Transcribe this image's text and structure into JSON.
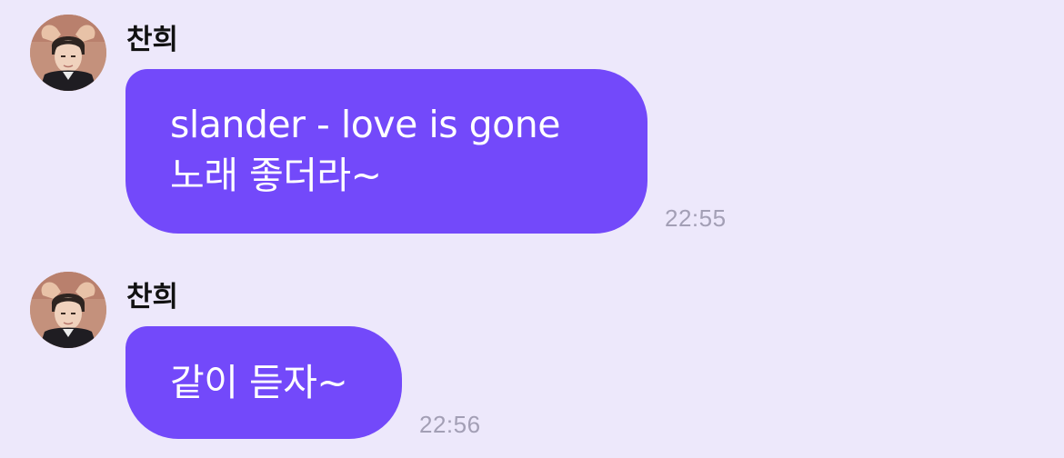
{
  "messages": [
    {
      "sender": "찬희",
      "lines": [
        "slander - love is gone",
        "노래 좋더라~"
      ],
      "time": "22:55"
    },
    {
      "sender": "찬희",
      "lines": [
        "같이 듣자~"
      ],
      "time": "22:56"
    }
  ],
  "colors": {
    "background": "#ede8fb",
    "bubble": "#7349fa",
    "bubble_text": "#ffffff",
    "timestamp": "#a39fb5",
    "sender": "#111111"
  }
}
